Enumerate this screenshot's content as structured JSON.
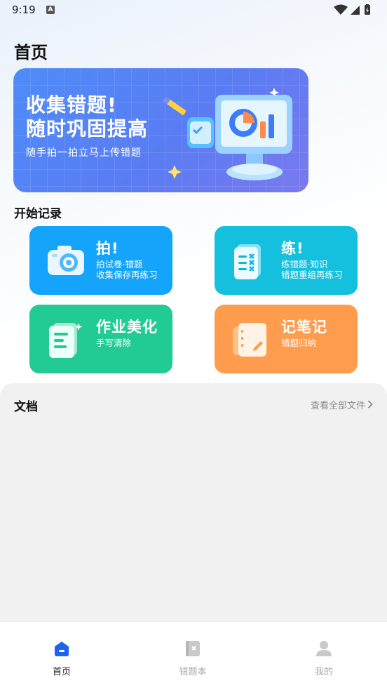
{
  "status_bar": {
    "time": "9:19",
    "badge": "A"
  },
  "header": {
    "title": "首页"
  },
  "banner": {
    "title_line1": "收集错题!",
    "title_line2": "随时巩固提高",
    "subtitle": "随手拍一拍立马上传错题"
  },
  "section": {
    "title": "开始记录"
  },
  "cards": [
    {
      "title": "拍!",
      "desc_line1": "拍试卷·错题",
      "desc_line2": "收集保存再练习",
      "color": "#14a4fb",
      "icon": "camera-icon"
    },
    {
      "title": "练!",
      "desc_line1": "练错题·知识",
      "desc_line2": "错题重组再练习",
      "color": "#14c0de",
      "icon": "practice-sheet-icon"
    },
    {
      "title": "作业美化",
      "desc_line1": "手写清除",
      "desc_line2": "",
      "color": "#22cb93",
      "icon": "document-icon"
    },
    {
      "title": "记笔记",
      "desc_line1": "错题归纳",
      "desc_line2": "",
      "color": "#ff9c4e",
      "icon": "notebook-icon"
    }
  ],
  "documents": {
    "title": "文档",
    "view_all": "查看全部文件"
  },
  "tabbar": {
    "items": [
      {
        "label": "首页",
        "icon": "home-icon",
        "active": true
      },
      {
        "label": "错题本",
        "icon": "mistake-book-icon",
        "active": false
      },
      {
        "label": "我的",
        "icon": "profile-icon",
        "active": false
      }
    ],
    "active_color": "#1f62f2",
    "inactive_color": "#aaaaaa"
  }
}
